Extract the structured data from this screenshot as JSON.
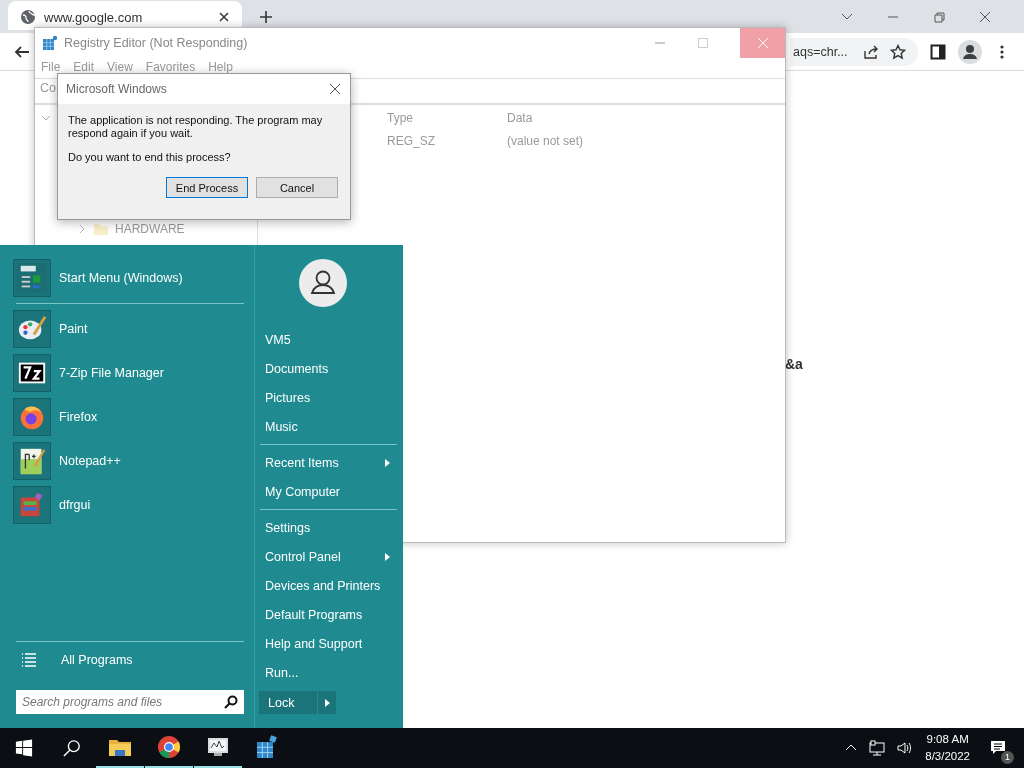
{
  "browser": {
    "tab": {
      "title": "www.google.com",
      "selected": true
    },
    "address_fragment": "aqs=chr...",
    "page_text_fragment": "&a"
  },
  "registry_editor": {
    "title": "Registry Editor (Not Responding)",
    "menu": [
      "File",
      "Edit",
      "View",
      "Favorites",
      "Help"
    ],
    "address": "Co",
    "tree": [
      {
        "label": "HARDWARE",
        "expanded": false
      }
    ],
    "columns": [
      "Type",
      "Data"
    ],
    "rows": [
      {
        "type": "REG_SZ",
        "data": "(value not set)"
      }
    ]
  },
  "dialog": {
    "title": "Microsoft Windows",
    "message": "The application is not responding. The program may respond again if you wait.",
    "question": "Do you want to end this process?",
    "buttons": [
      {
        "label": "End Process",
        "default": true
      },
      {
        "label": "Cancel",
        "default": false
      }
    ]
  },
  "start_menu": {
    "programs": [
      {
        "label": "Start Menu (Windows)"
      },
      {
        "label": "Paint"
      },
      {
        "label": "7-Zip File Manager"
      },
      {
        "label": "Firefox"
      },
      {
        "label": "Notepad++"
      },
      {
        "label": "dfrgui"
      }
    ],
    "all_programs": "All Programs",
    "search": {
      "placeholder": "Search programs and files"
    },
    "place_groups": [
      [
        {
          "label": "VM5",
          "submenu": false
        },
        {
          "label": "Documents",
          "submenu": false
        },
        {
          "label": "Pictures",
          "submenu": false
        },
        {
          "label": "Music",
          "submenu": false
        }
      ],
      [
        {
          "label": "Recent Items",
          "submenu": true
        },
        {
          "label": "My Computer",
          "submenu": false
        }
      ],
      [
        {
          "label": "Settings",
          "submenu": false
        },
        {
          "label": "Control Panel",
          "submenu": true
        },
        {
          "label": "Devices and Printers",
          "submenu": false
        },
        {
          "label": "Default Programs",
          "submenu": false
        },
        {
          "label": "Help and Support",
          "submenu": false
        },
        {
          "label": "Run...",
          "submenu": false
        }
      ]
    ],
    "lock": "Lock"
  },
  "taskbar": {
    "apps": [
      {
        "running": true
      },
      {
        "running": true
      },
      {
        "running": true
      },
      {
        "running": false
      }
    ],
    "clock": {
      "time": "9:08 AM",
      "date": "8/3/2022"
    },
    "notification_count": "1"
  }
}
